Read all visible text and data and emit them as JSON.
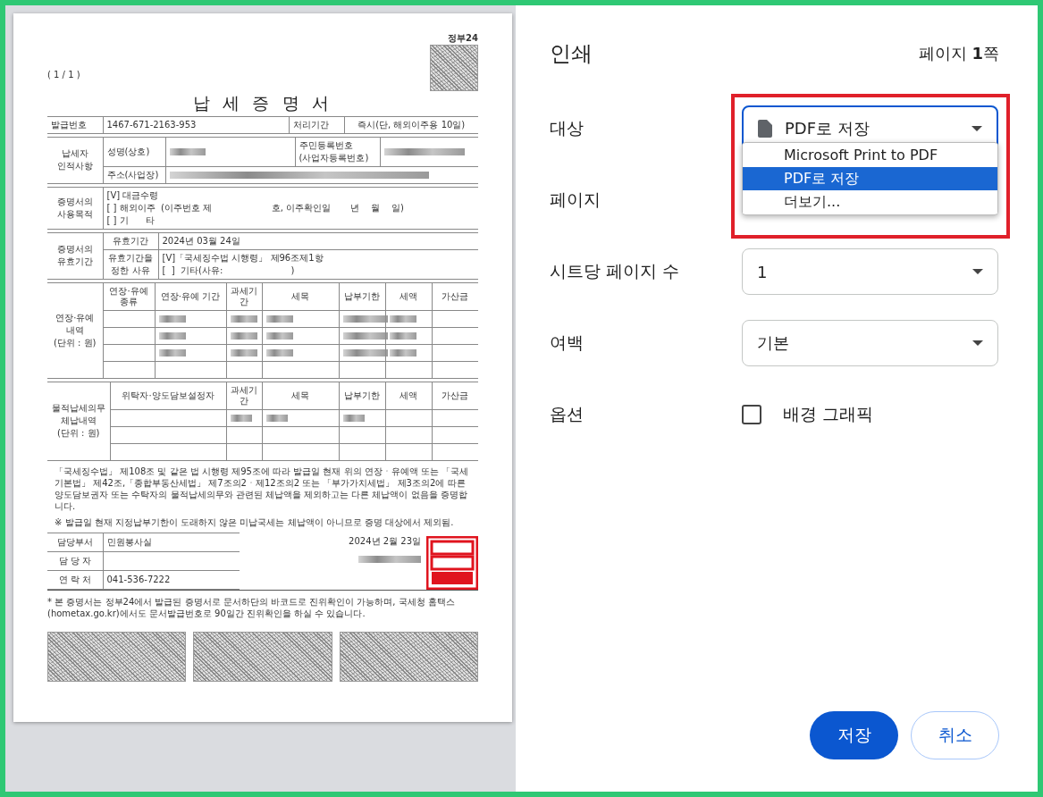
{
  "preview": {
    "qr_label": "정부24",
    "page_count": "( 1 / 1 )",
    "title": "납 세 증 명 서",
    "issue_row": [
      {
        "text": "발급번호",
        "kind": "label"
      },
      {
        "text": "1467-671-2163-953",
        "kind": "value"
      },
      {
        "text": "처리기간",
        "kind": "label"
      },
      {
        "text": "즉시(단, 해외이주용 10일)",
        "kind": "value"
      }
    ],
    "taxpayer": {
      "label": [
        "납세자",
        "인적사항"
      ],
      "name_label": "성명(상호)",
      "id_label": [
        "주민등록번호",
        "(사업자등록번호)"
      ],
      "address_label": "주소(사업장)"
    },
    "purpose": {
      "label": [
        "증명서의",
        "사용목적"
      ],
      "lines": [
        "[V] 대금수령",
        "[ ] 해외이주  (이주번호 제                     호, 이주확인일       년    월    일)",
        "[ ] 기      타"
      ]
    },
    "validity": {
      "label": [
        "증명서의",
        "유효기간"
      ],
      "rows": [
        {
          "label": [
            "유효기간"
          ],
          "lines": [
            "2024년 03월 24일"
          ]
        },
        {
          "label": [
            "유효기간을",
            "정한 사유"
          ],
          "lines": [
            "[V]「국세징수법 시행령」 제96조제1항",
            "[  ]  기타(사유:                        )"
          ]
        }
      ]
    },
    "deferral": {
      "label": [
        "연장·유예",
        "내역",
        "(단위 : 원)"
      ],
      "columns": [
        "연장·유예 종류",
        "연장·유예 기간",
        "과세기간",
        "세목",
        "납부기한",
        "세액",
        "가산금"
      ]
    },
    "arrears": {
      "label": [
        "물적납세의무",
        "체납내역",
        "(단위 : 원)"
      ],
      "columns": [
        "위탁자·양도담보설정자",
        "과세기간",
        "세목",
        "납부기한",
        "세액",
        "가산금"
      ]
    },
    "statement": "「국세징수법」 제108조 및 같은 법 시행령 제95조에 따라 발급일 현재 위의 연장ㆍ유예액 또는 「국세기본법」 제42조,「종합부동산세법」 제7조의2ㆍ제12조의2 또는 「부가가치세법」 제3조의2에 따른 양도담보권자 또는 수탁자의 물적납세의무와 관련된 체납액을 제외하고는 다른 체납액이 없음을 증명합니다.",
    "note": "※ 발급일 현재 지정납부기한이 도래하지 않은 미납국세는 체납액이 아니므로 증명 대상에서 제외됨.",
    "contact": [
      {
        "label": "담당부서",
        "value": "민원봉사실"
      },
      {
        "label": "담 당 자"
      },
      {
        "label": "연 락 처",
        "value": "041-536-7222"
      }
    ],
    "issue_date": "2024년 2월 23일",
    "footnote": "* 본 증명서는 정부24에서 발급된 증명서로 문서하단의 바코드로 진위확인이 가능하며, 국세청 홈택스(hometax.go.kr)에서도 문서발급번호로 90일간 진위확인을 하실 수 있습니다."
  },
  "dialog": {
    "title": "인쇄",
    "page_count": "페이지 **1**쪽",
    "settings": [
      {
        "label": "대상",
        "kind": "destination",
        "value": "PDF로 저장",
        "expanded": true,
        "highlighted": true,
        "options": [
          {
            "label": "Microsoft Print to PDF",
            "selected": false
          },
          {
            "label": "PDF로 저장",
            "selected": true
          },
          {
            "label": "더보기...",
            "selected": false
          }
        ]
      },
      {
        "label": "페이지",
        "kind": "covered"
      },
      {
        "label": "시트당 페이지 수",
        "kind": "select",
        "value": "1"
      },
      {
        "label": "여백",
        "kind": "select",
        "value": "기본"
      },
      {
        "label": "옵션",
        "kind": "checkbox",
        "value": "배경 그래픽",
        "checked": false
      }
    ],
    "buttons": [
      {
        "label": "저장",
        "kind": "primary"
      },
      {
        "label": "취소",
        "kind": "secondary"
      }
    ]
  }
}
